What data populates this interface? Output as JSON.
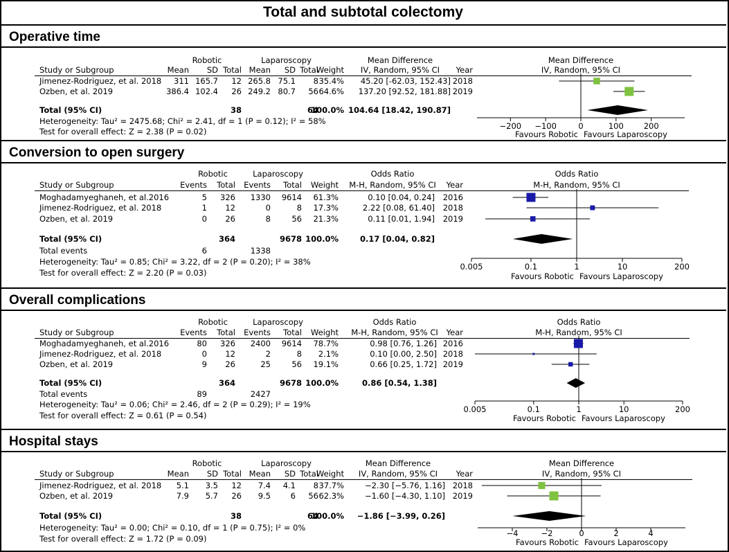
{
  "title": "Total and subtotal colectomy",
  "colors": {
    "md_box": "#7fc241",
    "or_box": "#1a1aa8",
    "diamond": "#000000"
  },
  "chart_data": [
    {
      "type": "forest",
      "section": "Operative time",
      "effect_header": "Mean Difference",
      "method": "IV, Random, 95% CI",
      "group_names": [
        "Robotic",
        "Laparoscopy"
      ],
      "col_headers": [
        "Mean",
        "SD",
        "Total",
        "Mean",
        "SD",
        "Total"
      ],
      "study_header": "Study or Subgroup",
      "weight_header": "Weight",
      "year_header": "Year",
      "studies": [
        {
          "name": "Jimenez-Rodriguez, et al. 2018",
          "cells": [
            "311",
            "165.7",
            "12",
            "265.8",
            "75.1",
            "8"
          ],
          "weight": "35.4%",
          "ci_text": "45.20 [-62.03, 152.43]",
          "year": "2018",
          "est": 45.2,
          "lo": -62.03,
          "hi": 152.43,
          "w": 35.4
        },
        {
          "name": "Ozben, et al. 2019",
          "cells": [
            "386.4",
            "102.4",
            "26",
            "249.2",
            "80.7",
            "56"
          ],
          "weight": "64.6%",
          "ci_text": "137.20 [92.52, 181.88]",
          "year": "2019",
          "est": 137.2,
          "lo": 92.52,
          "hi": 181.88,
          "w": 64.6
        }
      ],
      "total": {
        "label": "Total (95% CI)",
        "n1": "38",
        "n2": "64",
        "weight": "100.0%",
        "ci_text": "104.64 [18.42, 190.87]",
        "est": 104.64,
        "lo": 18.42,
        "hi": 190.87
      },
      "heterogeneity": "Heterogeneity: Tau² = 2475.68; Chi² = 2.41, df = 1 (P = 0.12); I² = 58%",
      "overall": "Test for overall effect: Z = 2.38 (P = 0.02)",
      "axis": {
        "scale": "linear",
        "range": [
          -295,
          295
        ],
        "ticks": [
          -200,
          -100,
          0,
          100,
          200
        ],
        "tick_labels": [
          "−200",
          "−100",
          "0",
          "100",
          "200"
        ]
      },
      "favours": [
        "Favours Robotic",
        "Favours Laparoscopy"
      ]
    },
    {
      "type": "forest",
      "section": "Conversion to open surgery",
      "effect_header": "Odds Ratio",
      "method": "M-H, Random, 95% CI",
      "group_names": [
        "Robotic",
        "Laparoscopy"
      ],
      "col_headers": [
        "Events",
        "Total",
        "Events",
        "Total"
      ],
      "study_header": "Study or Subgroup",
      "weight_header": "Weight",
      "year_header": "Year",
      "studies": [
        {
          "name": "Moghadamyeghaneh, et al.2016",
          "cells": [
            "5",
            "326",
            "1330",
            "9614"
          ],
          "weight": "61.3%",
          "ci_text": "0.10 [0.04, 0.24]",
          "year": "2016",
          "est": 0.1,
          "lo": 0.04,
          "hi": 0.24,
          "w": 61.3
        },
        {
          "name": "Jimenez-Rodriguez, et al. 2018",
          "cells": [
            "1",
            "12",
            "0",
            "8"
          ],
          "weight": "17.3%",
          "ci_text": "2.22 [0.08, 61.40]",
          "year": "2018",
          "est": 2.22,
          "lo": 0.08,
          "hi": 61.4,
          "w": 17.3
        },
        {
          "name": "Ozben, et al. 2019",
          "cells": [
            "0",
            "26",
            "8",
            "56"
          ],
          "weight": "21.3%",
          "ci_text": "0.11 [0.01, 1.94]",
          "year": "2019",
          "est": 0.11,
          "lo": 0.01,
          "hi": 1.94,
          "w": 21.3
        }
      ],
      "total": {
        "label": "Total (95% CI)",
        "n1": "364",
        "n2": "9678",
        "weight": "100.0%",
        "ci_text": "0.17 [0.04, 0.82]",
        "est": 0.17,
        "lo": 0.04,
        "hi": 0.82
      },
      "total_events": {
        "label": "Total events",
        "e1": "6",
        "e2": "1338"
      },
      "heterogeneity": "Heterogeneity: Tau² = 0.85; Chi² = 3.22, df = 2 (P = 0.20); I² = 38%",
      "overall": "Test for overall effect: Z = 2.20 (P = 0.03)",
      "axis": {
        "scale": "log",
        "range": [
          0.005,
          200
        ],
        "ticks": [
          0.005,
          0.1,
          1,
          10,
          200
        ],
        "tick_labels": [
          "0.005",
          "0.1",
          "1",
          "10",
          "200"
        ]
      },
      "favours": [
        "Favours Robotic",
        "Favours Laparoscopy"
      ]
    },
    {
      "type": "forest",
      "section": "Overall complications",
      "effect_header": "Odds Ratio",
      "method": "M-H, Random, 95% CI",
      "group_names": [
        "Robotic",
        "Laparoscopy"
      ],
      "col_headers": [
        "Events",
        "Total",
        "Events",
        "Total"
      ],
      "study_header": "Study or Subgroup",
      "weight_header": "Weight",
      "year_header": "Year",
      "studies": [
        {
          "name": "Moghadamyeghaneh, et al.2016",
          "cells": [
            "80",
            "326",
            "2400",
            "9614"
          ],
          "weight": "78.7%",
          "ci_text": "0.98 [0.76, 1.26]",
          "year": "2016",
          "est": 0.98,
          "lo": 0.76,
          "hi": 1.26,
          "w": 78.7
        },
        {
          "name": "Jimenez-Rodriguez, et al. 2018",
          "cells": [
            "0",
            "12",
            "2",
            "8"
          ],
          "weight": "2.1%",
          "ci_text": "0.10 [0.00, 2.50]",
          "year": "2018",
          "est": 0.1,
          "lo": 0.004,
          "hi": 2.5,
          "w": 2.1
        },
        {
          "name": "Ozben, et al. 2019",
          "cells": [
            "9",
            "26",
            "25",
            "56"
          ],
          "weight": "19.1%",
          "ci_text": "0.66 [0.25, 1.72]",
          "year": "2019",
          "est": 0.66,
          "lo": 0.25,
          "hi": 1.72,
          "w": 19.1
        }
      ],
      "total": {
        "label": "Total (95% CI)",
        "n1": "364",
        "n2": "9678",
        "weight": "100.0%",
        "ci_text": "0.86 [0.54, 1.38]",
        "est": 0.86,
        "lo": 0.54,
        "hi": 1.38
      },
      "total_events": {
        "label": "Total events",
        "e1": "89",
        "e2": "2427"
      },
      "heterogeneity": "Heterogeneity: Tau² = 0.06; Chi² = 2.46, df = 2 (P = 0.29); I² = 19%",
      "overall": "Test for overall effect: Z = 0.61 (P = 0.54)",
      "axis": {
        "scale": "log",
        "range": [
          0.005,
          200
        ],
        "ticks": [
          0.005,
          0.1,
          1,
          10,
          200
        ],
        "tick_labels": [
          "0.005",
          "0.1",
          "1",
          "10",
          "200"
        ]
      },
      "favours": [
        "Favours Robotic",
        "Favours Laparoscopy"
      ]
    },
    {
      "type": "forest",
      "section": "Hospital stays",
      "effect_header": "Mean Difference",
      "method": "IV, Random, 95% CI",
      "group_names": [
        "Robotic",
        "Laparoscopy"
      ],
      "col_headers": [
        "Mean",
        "SD",
        "Total",
        "Mean",
        "SD",
        "Total"
      ],
      "study_header": "Study or Subgroup",
      "weight_header": "Weight",
      "year_header": "Year",
      "studies": [
        {
          "name": "Jimenez-Rodriguez, et al. 2018",
          "cells": [
            "5.1",
            "3.5",
            "12",
            "7.4",
            "4.1",
            "8"
          ],
          "weight": "37.7%",
          "ci_text": "−2.30 [−5.76, 1.16]",
          "year": "2018",
          "est": -2.3,
          "lo": -5.76,
          "hi": 1.16,
          "w": 37.7
        },
        {
          "name": "Ozben, et al. 2019",
          "cells": [
            "7.9",
            "5.7",
            "26",
            "9.5",
            "6",
            "56"
          ],
          "weight": "62.3%",
          "ci_text": "−1.60 [−4.30, 1.10]",
          "year": "2019",
          "est": -1.6,
          "lo": -4.3,
          "hi": 1.1,
          "w": 62.3
        }
      ],
      "total": {
        "label": "Total (95% CI)",
        "n1": "38",
        "n2": "64",
        "weight": "100.0%",
        "ci_text": "−1.86 [−3.99, 0.26]",
        "est": -1.86,
        "lo": -3.99,
        "hi": 0.26
      },
      "heterogeneity": "Heterogeneity: Tau² = 0.00; Chi² = 0.10, df = 1 (P = 0.75); I² = 0%",
      "overall": "Test for overall effect: Z = 1.72 (P = 0.09)",
      "axis": {
        "scale": "linear",
        "range": [
          -6,
          6
        ],
        "ticks": [
          -4,
          -2,
          0,
          2,
          4
        ],
        "tick_labels": [
          "−4",
          "−2",
          "0",
          "2",
          "4"
        ]
      },
      "favours": [
        "Favours Robotic",
        "Favours Laparoscopy"
      ]
    }
  ]
}
